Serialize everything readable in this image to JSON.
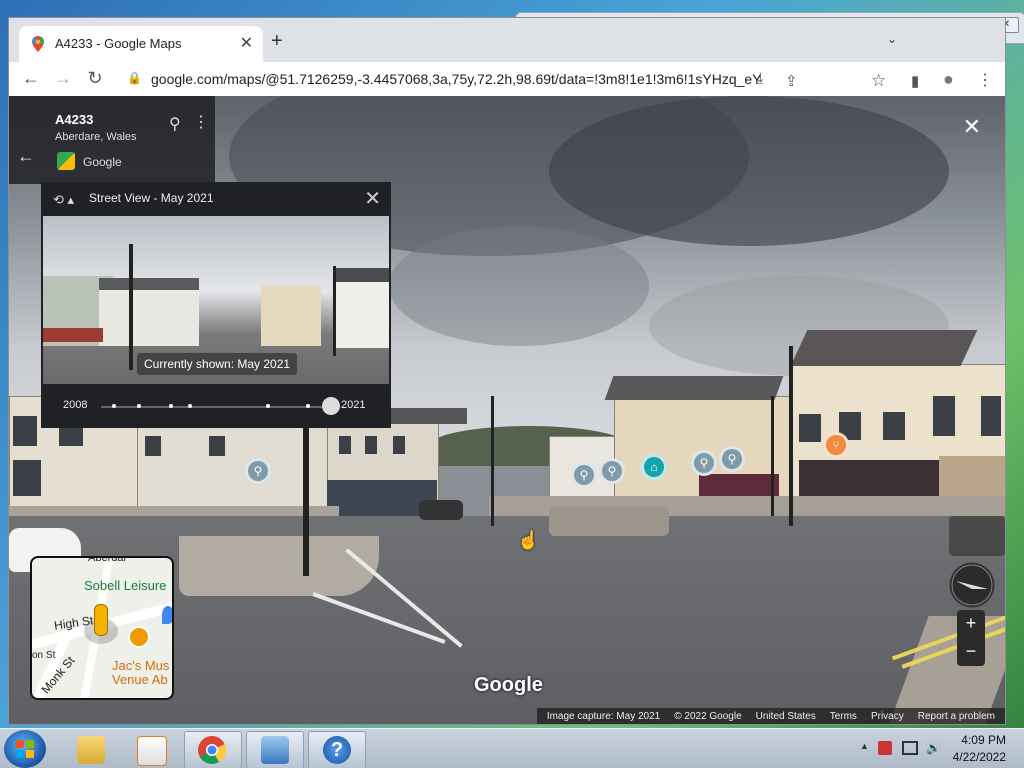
{
  "browser": {
    "tab_title": "A4233 - Google Maps",
    "tab_close": "✕",
    "new_tab": "+",
    "tab_list": "⌄",
    "url": "google.com/maps/@51.7126259,-3.4457068,3a,75y,72.2h,98.69t/data=!3m8!1e1!3m6!1sYHzq_eY2QNY...",
    "back": "←",
    "forward": "→",
    "reload": "↻",
    "lock": "🔒",
    "install": "⤓",
    "share": "⇪",
    "star": "☆",
    "sidepanel": "▮",
    "profile": "●",
    "menu": "⋮"
  },
  "place": {
    "name": "A4233",
    "location": "Aberdare, Wales",
    "provider": "Google",
    "back": "←",
    "pin": "⚲",
    "more": "⋮"
  },
  "timeline": {
    "title": "Street View - May 2021",
    "history_icon": "⟲ ▴",
    "close": "✕",
    "tooltip": "Currently shown: May 2021",
    "start_year": "2008",
    "end_year": "2021"
  },
  "streetview": {
    "close": "✕",
    "watermark": "Google",
    "cursor": "☝"
  },
  "minimap": {
    "label_sobell": "Sobell Leisure",
    "label_aberdare": "Aberdar",
    "label_high_st": "High St",
    "label_jacs": "Jac's Mus",
    "label_venue": "Venue Ab",
    "label_monk_st": "Monk St",
    "label_on_st": "on St"
  },
  "controls": {
    "zoom_in": "+",
    "zoom_out": "−"
  },
  "footer": {
    "capture": "Image capture: May 2021",
    "copyright": "© 2022 Google",
    "country": "United States",
    "terms": "Terms",
    "privacy": "Privacy",
    "report": "Report a problem"
  },
  "taskbar": {
    "time": "4:09 PM",
    "date": "4/22/2022",
    "tray_arrow": "▲",
    "tray_volume": "🔊",
    "help_icon": "?"
  },
  "background_window": {
    "min": "–",
    "max": "□",
    "close": "✕"
  }
}
